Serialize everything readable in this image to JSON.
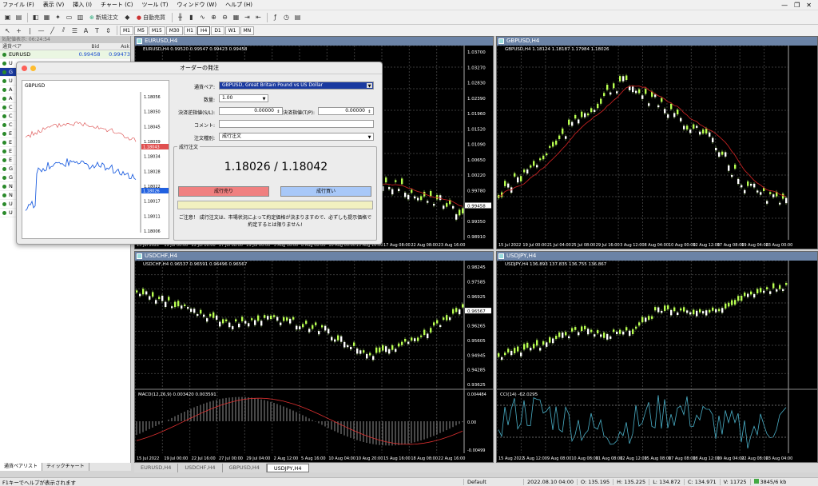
{
  "menu": [
    "ファイル (F)",
    "表示 (V)",
    "挿入 (I)",
    "チャート (C)",
    "ツール (T)",
    "ウィンドウ (W)",
    "ヘルプ (H)"
  ],
  "window_controls": [
    "—",
    "❐",
    "✕"
  ],
  "toolbar": {
    "new_order": "新規注文",
    "auto_trade": "自動売買",
    "timeframes": [
      "M1",
      "M5",
      "M15",
      "M30",
      "H1",
      "H4",
      "D1",
      "W1",
      "MN"
    ],
    "active_timeframe": "H4"
  },
  "market_watch": {
    "header": "気配値表示: 06:24:54",
    "columns": [
      "通貨ペア",
      "Bid",
      "Ask"
    ],
    "rows": [
      {
        "symbol": "EURUSD",
        "bid": "0.99458",
        "ask": "0.99473"
      },
      {
        "symbol": "U",
        "bid": "",
        "ask": ""
      },
      {
        "symbol": "G",
        "bid": "",
        "ask": ""
      },
      {
        "symbol": "U",
        "bid": "",
        "ask": ""
      },
      {
        "symbol": "A",
        "bid": "",
        "ask": ""
      },
      {
        "symbol": "A",
        "bid": "",
        "ask": ""
      },
      {
        "symbol": "C",
        "bid": "",
        "ask": ""
      },
      {
        "symbol": "C",
        "bid": "",
        "ask": ""
      },
      {
        "symbol": "C",
        "bid": "",
        "ask": ""
      },
      {
        "symbol": "E",
        "bid": "",
        "ask": ""
      },
      {
        "symbol": "E",
        "bid": "",
        "ask": ""
      },
      {
        "symbol": "E",
        "bid": "",
        "ask": ""
      },
      {
        "symbol": "E",
        "bid": "",
        "ask": ""
      },
      {
        "symbol": "G",
        "bid": "",
        "ask": ""
      },
      {
        "symbol": "G",
        "bid": "",
        "ask": ""
      },
      {
        "symbol": "N",
        "bid": "",
        "ask": ""
      },
      {
        "symbol": "N",
        "bid": "",
        "ask": ""
      },
      {
        "symbol": "U",
        "bid": "",
        "ask": ""
      },
      {
        "symbol": "U",
        "bid": "",
        "ask": ""
      }
    ],
    "tabs": [
      "通貨ペアリスト",
      "ティックチャート"
    ]
  },
  "charts": [
    {
      "id": "eurusd",
      "title": "EURUSD,H4",
      "info": "EURUSD,H4  0.99520 0.99547 0.99423 0.99458",
      "prices": [
        "1.03700",
        "1.03270",
        "1.02830",
        "1.02390",
        "1.01960",
        "1.01520",
        "1.01090",
        "1.00650",
        "1.00220",
        "0.99780",
        "0.99458",
        "0.99350",
        "0.98910"
      ],
      "current_price": "0.99458",
      "dates": [
        "15 Jul 2022",
        "19 Jul 00:00",
        "22 Jul 16:00",
        "27 Jul 08:00",
        "29 Jul 00:00",
        "3 Aug 16:00",
        "8 Aug 08:00",
        "10 Aug 00:00",
        "15 Aug 16:00",
        "17 Aug 08:00",
        "22 Aug 08:00",
        "23 Aug 16:00"
      ]
    },
    {
      "id": "gbpusd",
      "title": "GBPUSD,H4",
      "info": "GBPUSD,H4  1.18124 1.18187 1.17984 1.18026",
      "prices": [],
      "current_price": "",
      "dates": [
        "15 Jul 2022",
        "19 Jul 00:00",
        "21 Jul 04:00",
        "25 Jul 08:00",
        "29 Jul 16:00",
        "3 Aug 12:00",
        "8 Aug 04:00",
        "10 Aug 00:00",
        "12 Aug 12:00",
        "17 Aug 08:00",
        "19 Aug 04:00",
        "23 Aug 00:00"
      ]
    },
    {
      "id": "usdchf",
      "title": "USDCHF,H4",
      "info": "USDCHF,H4  0.96537 0.96591 0.96496 0.96567",
      "prices": [
        "0.98245",
        "0.97585",
        "0.96925",
        "0.96567",
        "0.96265",
        "0.95605",
        "0.94945",
        "0.94285",
        "0.93625"
      ],
      "current_price": "0.96567",
      "dates": [
        "15 Jul 2022",
        "19 Jul 00:00",
        "22 Jul 16:00",
        "27 Jul 00:00",
        "29 Jul 04:00",
        "2 Aug 12:00",
        "5 Aug 16:00",
        "10 Aug 04:00",
        "10 Aug 20:00",
        "15 Aug 16:00",
        "18 Aug 08:00",
        "22 Aug 16:00"
      ],
      "indicator_label": "MACD(12,26,9) 0.003420 0.003591",
      "indicator_ticks": [
        "0.004484",
        "0.00",
        "-0.00499"
      ]
    },
    {
      "id": "usdjpy",
      "title": "USDJPY,H4",
      "info": "USDJPY,H4  136.893 137.835 136.755 136.867",
      "prices": [],
      "current_price": "",
      "dates": [
        "15 Aug 2022",
        "5 Aug 12:00",
        "9 Aug 08:00",
        "10 Aug 08:00",
        "11 Aug 08:00",
        "12 Aug 12:00",
        "15 Aug 08:00",
        "17 Aug 08:00",
        "18 Aug 12:00",
        "19 Aug 04:00",
        "22 Aug 08:00",
        "23 Aug 04:00"
      ],
      "indicator_label": "CCI(14) -62.0295",
      "indicator_ticks": []
    }
  ],
  "chart_tabs": [
    "EURUSD,H4",
    "USDCHF,H4",
    "GBPUSD,H4",
    "USDJPY,H4"
  ],
  "active_chart_tab": "USDJPY,H4",
  "order_dialog": {
    "title": "オーダーの発注",
    "mini_chart": {
      "symbol": "GBPUSD",
      "prices": [
        "1.18056",
        "1.18050",
        "1.18045",
        "1.18039",
        "1.18034",
        "1.18028",
        "1.18022",
        "1.18017",
        "1.18011",
        "1.18006"
      ],
      "ask_tag": "1.18043",
      "bid_tag": "1.18026"
    },
    "fields": {
      "symbol_label": "通貨ペア:",
      "symbol_value": "GBPUSD, Great Britain Pound vs US Dollar",
      "volume_label": "数量:",
      "volume_value": "1.00",
      "sl_label": "決済逆指値(S/L):",
      "sl_value": "0.00000",
      "tp_label": "決済指値(T/P):",
      "tp_value": "0.00000",
      "comment_label": "コメント:",
      "comment_value": "",
      "type_label": "注文種別:",
      "type_value": "成行注文"
    },
    "group_label": "成行注文",
    "quote": "1.18026 / 1.18042",
    "sell_label": "成行売り",
    "buy_label": "成行買い",
    "notice_line1": "ご注意！ 成行注文は、市場状況によって約定価格が決まりますので、必ずしも提示価格で",
    "notice_line2": "約定するとは限りません!"
  },
  "status": {
    "help": "F1キーでヘルプが表示されます",
    "profile": "Default",
    "datetime": "2022.08.10 04:00",
    "open": "O: 135.195",
    "high": "H: 135.225",
    "low": "L: 134.872",
    "close": "C: 134.971",
    "volume": "V: 11725",
    "traffic": "3845/6 kb"
  },
  "colors": {
    "title_bar": "#6b83a6",
    "bull": "#b8ff50",
    "bear": "#ffffff",
    "ma": "#c02020",
    "sell": "#f08080",
    "buy": "#a8c8f8"
  }
}
